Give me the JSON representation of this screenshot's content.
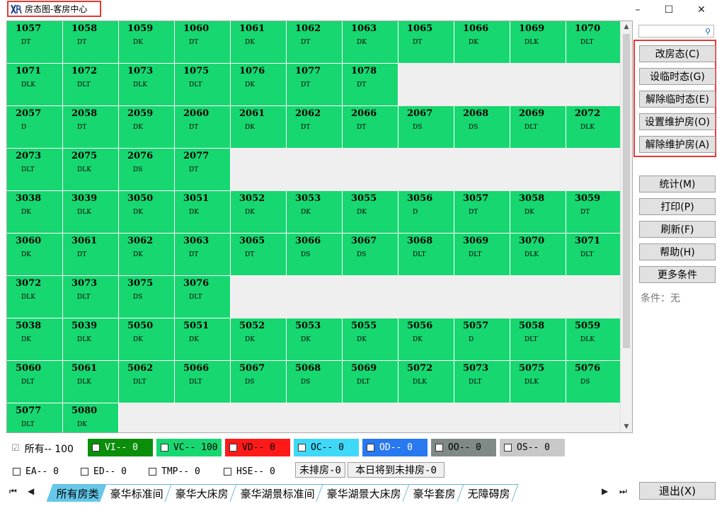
{
  "window": {
    "title": "房态图-客房中心",
    "minimize": "–",
    "maximize": "☐",
    "close": "✕"
  },
  "rooms": [
    [
      {
        "no": "1057",
        "st": "DT"
      },
      {
        "no": "1058",
        "st": "DT"
      },
      {
        "no": "1059",
        "st": "DK"
      },
      {
        "no": "1060",
        "st": "DT"
      },
      {
        "no": "1061",
        "st": "DK"
      },
      {
        "no": "1062",
        "st": "DT"
      },
      {
        "no": "1063",
        "st": "DK"
      },
      {
        "no": "1065",
        "st": "DT"
      },
      {
        "no": "1066",
        "st": "DK"
      },
      {
        "no": "1069",
        "st": "DLK"
      },
      {
        "no": "1070",
        "st": "DLT"
      }
    ],
    [
      {
        "no": "1071",
        "st": "DLK"
      },
      {
        "no": "1072",
        "st": "DLT"
      },
      {
        "no": "1073",
        "st": "DLK"
      },
      {
        "no": "1075",
        "st": "DLT"
      },
      {
        "no": "1076",
        "st": "DK"
      },
      {
        "no": "1077",
        "st": "DT"
      },
      {
        "no": "1078",
        "st": "DT"
      }
    ],
    [
      {
        "no": "2057",
        "st": "D"
      },
      {
        "no": "2058",
        "st": "DT"
      },
      {
        "no": "2059",
        "st": "DK"
      },
      {
        "no": "2060",
        "st": "DT"
      },
      {
        "no": "2061",
        "st": "DK"
      },
      {
        "no": "2062",
        "st": "DT"
      },
      {
        "no": "2066",
        "st": "DT"
      },
      {
        "no": "2067",
        "st": "DS"
      },
      {
        "no": "2068",
        "st": "DS"
      },
      {
        "no": "2069",
        "st": "DLT"
      },
      {
        "no": "2072",
        "st": "DLK"
      }
    ],
    [
      {
        "no": "2073",
        "st": "DLT"
      },
      {
        "no": "2075",
        "st": "DLK"
      },
      {
        "no": "2076",
        "st": "DS"
      },
      {
        "no": "2077",
        "st": "DT"
      }
    ],
    [
      {
        "no": "3038",
        "st": "DK"
      },
      {
        "no": "3039",
        "st": "DLK"
      },
      {
        "no": "3050",
        "st": "DK"
      },
      {
        "no": "3051",
        "st": "DK"
      },
      {
        "no": "3052",
        "st": "DK"
      },
      {
        "no": "3053",
        "st": "DK"
      },
      {
        "no": "3055",
        "st": "DK"
      },
      {
        "no": "3056",
        "st": "D"
      },
      {
        "no": "3057",
        "st": "DT"
      },
      {
        "no": "3058",
        "st": "DK"
      },
      {
        "no": "3059",
        "st": "DT"
      }
    ],
    [
      {
        "no": "3060",
        "st": "DK"
      },
      {
        "no": "3061",
        "st": "DT"
      },
      {
        "no": "3062",
        "st": "DK"
      },
      {
        "no": "3063",
        "st": "DT"
      },
      {
        "no": "3065",
        "st": "DT"
      },
      {
        "no": "3066",
        "st": "DS"
      },
      {
        "no": "3067",
        "st": "DS"
      },
      {
        "no": "3068",
        "st": "DLT"
      },
      {
        "no": "3069",
        "st": "DLT"
      },
      {
        "no": "3070",
        "st": "DLK"
      },
      {
        "no": "3071",
        "st": "DLT"
      }
    ],
    [
      {
        "no": "3072",
        "st": "DLK"
      },
      {
        "no": "3073",
        "st": "DLT"
      },
      {
        "no": "3075",
        "st": "DS"
      },
      {
        "no": "3076",
        "st": "DLT"
      }
    ],
    [
      {
        "no": "5038",
        "st": "DK"
      },
      {
        "no": "5039",
        "st": "DLK"
      },
      {
        "no": "5050",
        "st": "DK"
      },
      {
        "no": "5051",
        "st": "DK"
      },
      {
        "no": "5052",
        "st": "DK"
      },
      {
        "no": "5053",
        "st": "DK"
      },
      {
        "no": "5055",
        "st": "DK"
      },
      {
        "no": "5056",
        "st": "DK"
      },
      {
        "no": "5057",
        "st": "D"
      },
      {
        "no": "5058",
        "st": "DLT"
      },
      {
        "no": "5059",
        "st": "DLK"
      }
    ],
    [
      {
        "no": "5060",
        "st": "DLT"
      },
      {
        "no": "5061",
        "st": "DLK"
      },
      {
        "no": "5062",
        "st": "DLT"
      },
      {
        "no": "5066",
        "st": "DLT"
      },
      {
        "no": "5067",
        "st": "DS"
      },
      {
        "no": "5068",
        "st": "DS"
      },
      {
        "no": "5069",
        "st": "DLT"
      },
      {
        "no": "5072",
        "st": "DLK"
      },
      {
        "no": "5073",
        "st": "DLT"
      },
      {
        "no": "5075",
        "st": "DLK"
      },
      {
        "no": "5076",
        "st": "DS"
      }
    ],
    [
      {
        "no": "5077",
        "st": "DLT"
      },
      {
        "no": "5080",
        "st": "DK"
      }
    ]
  ],
  "panel": {
    "buttons": [
      "改房态(C)",
      "设临时态(G)",
      "解除临时态(E)",
      "设置维护房(O)",
      "解除维护房(A)",
      "统计(M)",
      "打印(P)",
      "刷新(F)",
      "帮助(H)",
      "更多条件"
    ],
    "condition": "条件：无"
  },
  "legend": {
    "all": "所有-- 100",
    "VI": "VI-- 0",
    "VC": "VC-- 100",
    "VD": "VD-- 0",
    "OC": "OC-- 0",
    "OD": "OD-- 0",
    "OO": "OO-- 0",
    "OS": "OS-- 0",
    "EA": "EA-- 0",
    "ED": "ED-- 0",
    "TMP": "TMP-- 0",
    "HSE": "HSE-- 0",
    "unassigned": "未排房-0",
    "today_unassigned": "本日将到未排房-0",
    "colors": {
      "VI": "#0b8f0b",
      "VC": "#17d770",
      "VD": "#ff1a1a",
      "OC": "#40d8f8",
      "OD": "#2878f0",
      "OO": "#7f8a86",
      "OS": "#c8c8c8"
    }
  },
  "tabs": [
    "所有房类",
    "豪华标准间",
    "豪华大床房",
    "豪华湖景标准间",
    "豪华湖景大床房",
    "豪华套房",
    "无障碍房"
  ],
  "nav": {
    "first": "⏮",
    "prev": "◀",
    "next": "▶",
    "last": "⏭"
  },
  "exit": "退出(X)"
}
